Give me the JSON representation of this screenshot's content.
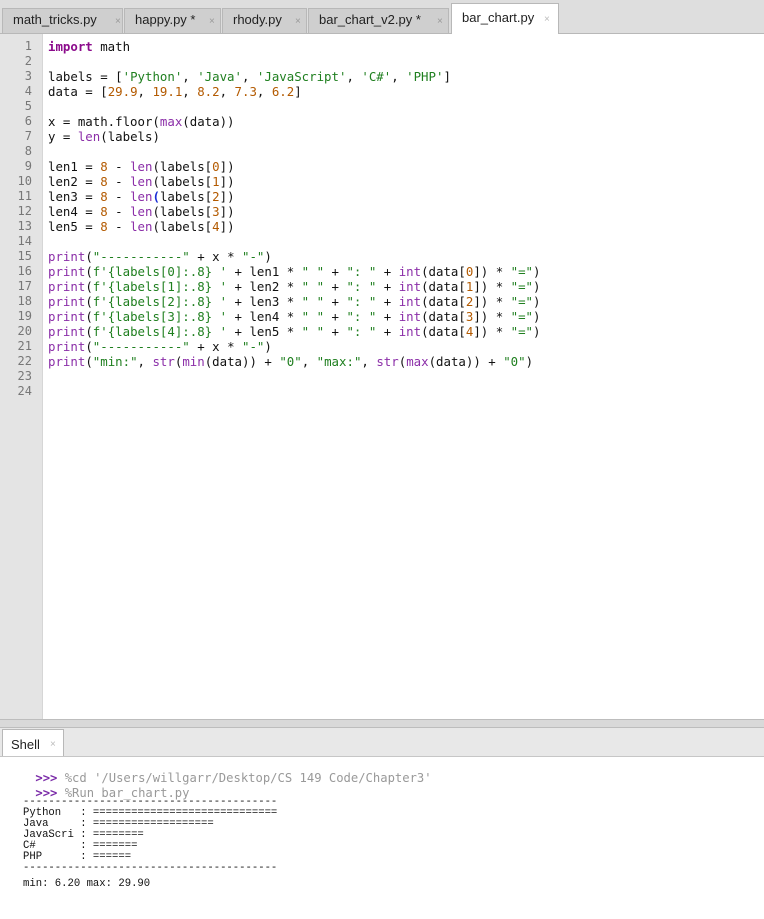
{
  "tabs": [
    {
      "label": "math_tricks.py",
      "close": "×"
    },
    {
      "label": "happy.py *",
      "close": "×"
    },
    {
      "label": "rhody.py",
      "close": "×"
    },
    {
      "label": "bar_chart_v2.py *",
      "close": "×"
    },
    {
      "label": "bar_chart.py",
      "close": "×",
      "active": true
    }
  ],
  "editor": {
    "line_numbers": [
      "1",
      "2",
      "3",
      "4",
      "5",
      "6",
      "7",
      "8",
      "9",
      "10",
      "11",
      "12",
      "13",
      "14",
      "15",
      "16",
      "17",
      "18",
      "19",
      "20",
      "21",
      "22",
      "23",
      "24"
    ],
    "code_lines": [
      "import math",
      "",
      "labels = ['Python', 'Java', 'JavaScript', 'C#', 'PHP']",
      "data = [29.9, 19.1, 8.2, 7.3, 6.2]",
      "",
      "x = math.floor(max(data))",
      "y = len(labels)",
      "",
      "len1 = 8 - len(labels[0])",
      "len2 = 8 - len(labels[1])",
      "len3 = 8 - len(labels[2])",
      "len4 = 8 - len(labels[3])",
      "len5 = 8 - len(labels[4])",
      "",
      "print(\"-----------\" + x * \"-\")",
      "print(f'{labels[0]:.8} ' + len1 * \" \" + \": \" + int(data[0]) * \"=\")",
      "print(f'{labels[1]:.8} ' + len2 * \" \" + \": \" + int(data[1]) * \"=\")",
      "print(f'{labels[2]:.8} ' + len3 * \" \" + \": \" + int(data[2]) * \"=\")",
      "print(f'{labels[3]:.8} ' + len4 * \" \" + \": \" + int(data[3]) * \"=\")",
      "print(f'{labels[4]:.8} ' + len5 * \" \" + \": \" + int(data[4]) * \"=\")",
      "print(\"-----------\" + x * \"-\")",
      "print(\"min:\", str(min(data)) + \"0\", \"max:\", str(max(data)) + \"0\")",
      "",
      ""
    ]
  },
  "shell": {
    "tab_label": "Shell",
    "tab_close": "×",
    "prompt": ">>>",
    "commands": [
      "%cd '/Users/willgarr/Desktop/CS 149 Code/Chapter3'",
      "%Run bar_chart.py"
    ],
    "output_lines": [
      "----------------------------------------",
      "Python   : =============================",
      "Java     : ===================",
      "JavaScri : ========",
      "C#       : =======",
      "PHP      : ======",
      "----------------------------------------",
      "min: 6.20 max: 29.90"
    ]
  }
}
